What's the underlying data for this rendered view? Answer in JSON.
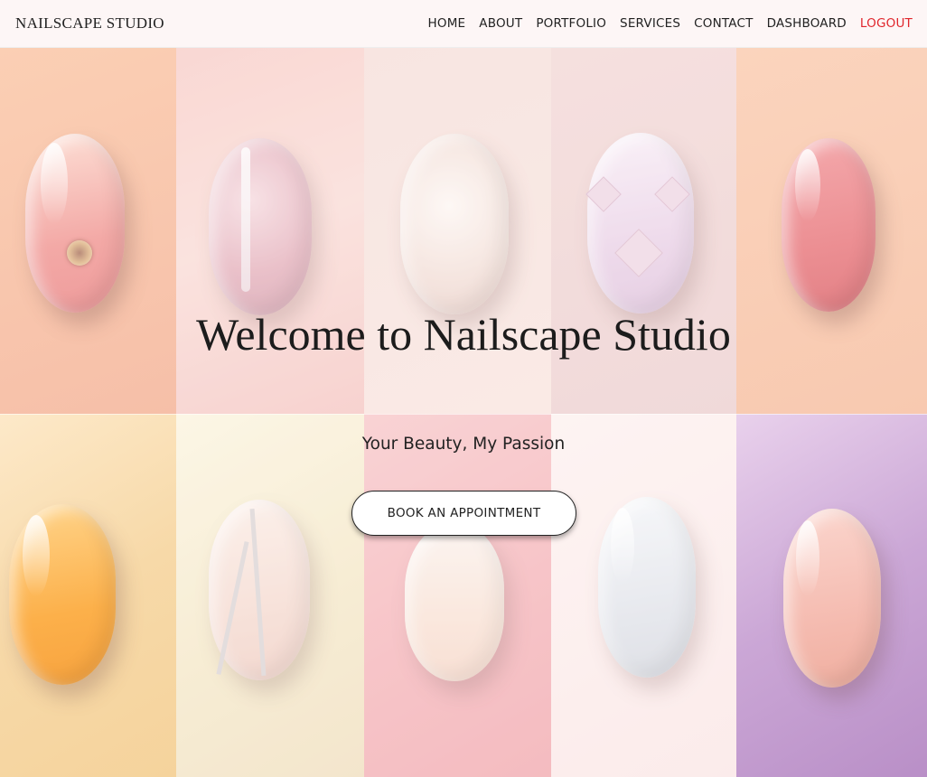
{
  "navbar": {
    "brand": "NAILSCAPE STUDIO",
    "links": [
      "HOME",
      "ABOUT",
      "PORTFOLIO",
      "SERVICES",
      "CONTACT",
      "DASHBOARD",
      "LOGOUT"
    ]
  },
  "hero": {
    "title": "Welcome to Nailscape Studio",
    "subtitle": "Your Beauty, My Passion",
    "cta_label": "BOOK AN APPOINTMENT"
  },
  "colors": {
    "logout": "#e0262c",
    "text": "#222222",
    "navbar_bg": "#fdf6f6"
  }
}
